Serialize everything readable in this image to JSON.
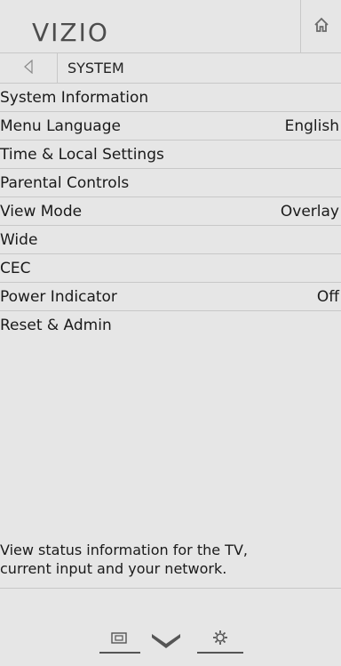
{
  "brand": {
    "logo_text": "VIZIO"
  },
  "header": {
    "home_icon": "home-icon"
  },
  "breadcrumb": {
    "back_icon": "back-arrow-icon",
    "title": "SYSTEM"
  },
  "menu": {
    "items": [
      {
        "label": "System Information",
        "value": ""
      },
      {
        "label": "Menu Language",
        "value": "English"
      },
      {
        "label": "Time & Local Settings",
        "value": ""
      },
      {
        "label": "Parental Controls",
        "value": ""
      },
      {
        "label": "View Mode",
        "value": "Overlay"
      },
      {
        "label": "Wide",
        "value": ""
      },
      {
        "label": "CEC",
        "value": ""
      },
      {
        "label": "Power Indicator",
        "value": "Off"
      },
      {
        "label": "Reset & Admin",
        "value": ""
      }
    ]
  },
  "help": {
    "line1": "View status information for the TV,",
    "line2": "current input and your network."
  },
  "footer": {
    "icons": [
      "input-icon",
      "vizio-v-icon",
      "settings-icon"
    ]
  }
}
